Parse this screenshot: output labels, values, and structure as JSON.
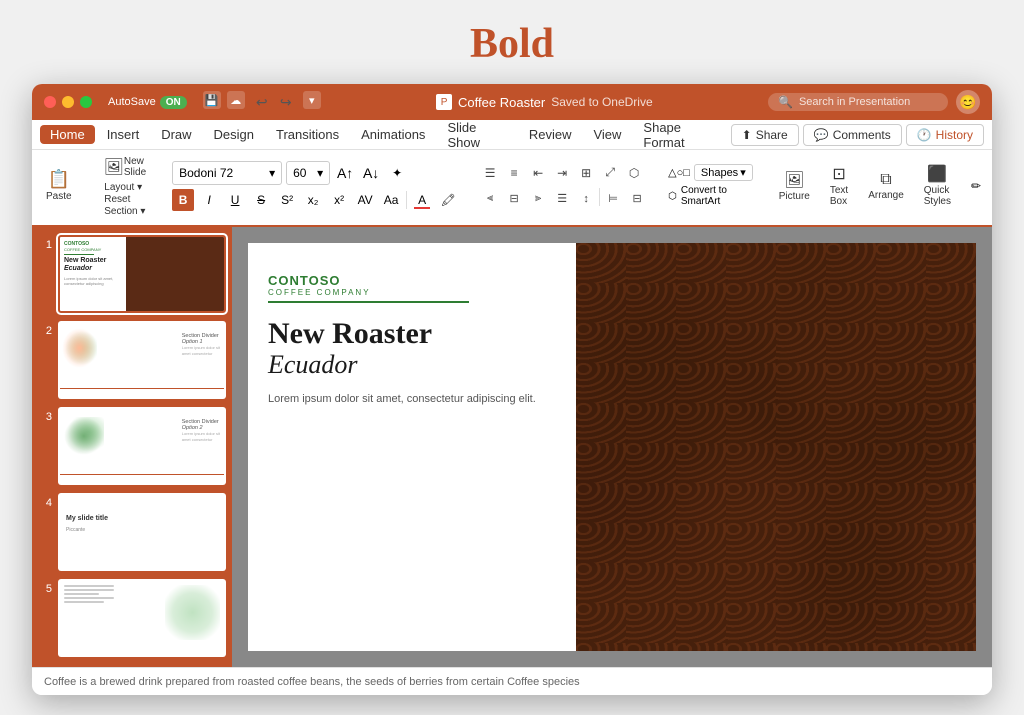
{
  "page": {
    "title": "Bold"
  },
  "titlebar": {
    "autosave_label": "AutoSave",
    "autosave_state": "ON",
    "file_title": "Coffee Roaster",
    "save_status": "Saved to OneDrive",
    "search_placeholder": "Search in Presentation"
  },
  "menubar": {
    "items": [
      {
        "label": "Home",
        "active": true
      },
      {
        "label": "Insert",
        "active": false
      },
      {
        "label": "Draw",
        "active": false
      },
      {
        "label": "Design",
        "active": false
      },
      {
        "label": "Transitions",
        "active": false
      },
      {
        "label": "Animations",
        "active": false
      },
      {
        "label": "Slide Show",
        "active": false
      },
      {
        "label": "Review",
        "active": false
      },
      {
        "label": "View",
        "active": false
      },
      {
        "label": "Shape Format",
        "active": false
      }
    ],
    "share_label": "Share",
    "comments_label": "Comments",
    "history_label": "History"
  },
  "ribbon": {
    "paste_label": "Paste",
    "new_slide_label": "New Slide",
    "layout_label": "Layout ▾",
    "reset_label": "Reset",
    "section_label": "Section ▾",
    "font_name": "Bodoni 72",
    "font_size": "60",
    "bold_label": "B",
    "italic_label": "I",
    "underline_label": "U",
    "strikethrough_label": "S",
    "shapes_label": "Shapes",
    "picture_label": "Picture",
    "textbox_label": "Text Box",
    "arrange_label": "Arrange",
    "quick_styles_label": "Quick Styles",
    "convert_smartart_label": "Convert to SmartArt"
  },
  "slides": [
    {
      "num": "1",
      "active": true,
      "brand": "CONTOSO",
      "title": "New Roaster",
      "subtitle": "Ecuador"
    },
    {
      "num": "2",
      "active": false,
      "section_text": "Section Divider Option 1"
    },
    {
      "num": "3",
      "active": false,
      "section_text": "Section Divider Option 2"
    },
    {
      "num": "4",
      "active": false,
      "title": "My slide title",
      "sub": "Piccante"
    },
    {
      "num": "5",
      "active": false
    }
  ],
  "canvas": {
    "brand": "CONTOSO",
    "brand_sub": "COFFEE COMPANY",
    "main_title": "New Roaster",
    "subtitle": "Ecuador",
    "body_text": "Lorem ipsum dolor sit amet, consectetur adipiscing elit."
  },
  "statusbar": {
    "text": "Coffee is a brewed drink prepared from roasted coffee beans, the seeds of berries from certain Coffee species"
  }
}
